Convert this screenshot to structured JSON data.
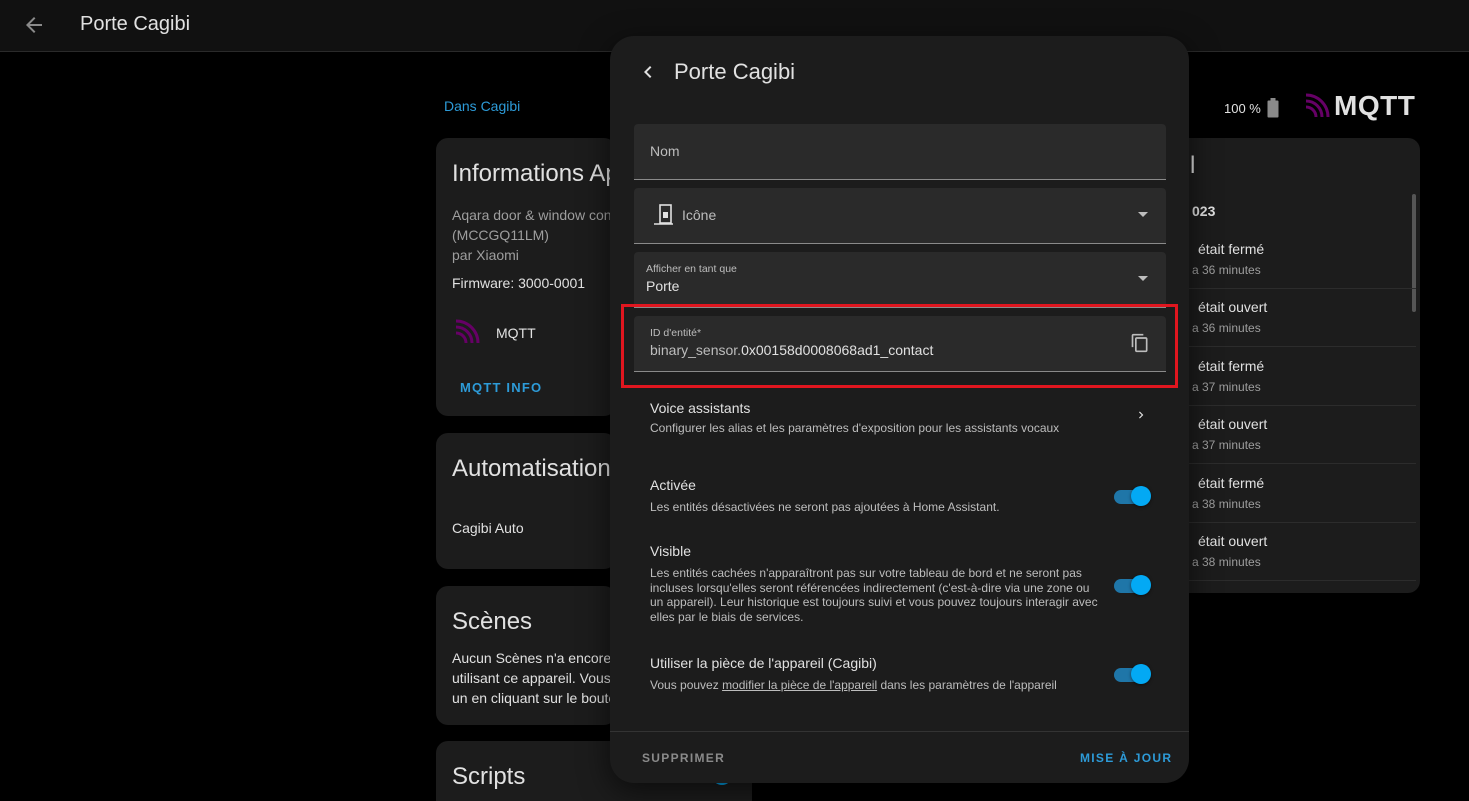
{
  "topbar": {
    "title": "Porte Cagibi"
  },
  "background": {
    "area_link": "Dans Cagibi",
    "battery": "100 %",
    "mqtt_logo_text": "MQTT",
    "info_card": {
      "title": "Informations Ap",
      "model_line1": "Aqara door & window con",
      "model_line2": "(MCCGQ11LM)",
      "manufacturer": "par Xiaomi",
      "firmware": "Firmware: 3000-0001",
      "integration": "MQTT",
      "button": "MQTT INFO"
    },
    "automation_card": {
      "title": "Automatisation",
      "item": "Cagibi Auto"
    },
    "scenes_card": {
      "title": "Scènes",
      "line1": "Aucun Scènes n'a encore",
      "line2": "utilisant ce appareil. Vous",
      "line3": "un en cliquant sur le bouto"
    },
    "scripts_card": {
      "title": "Scripts"
    },
    "logbook": {
      "header_fragment": "l",
      "date_fragment": "023",
      "items": [
        {
          "text": "était fermé",
          "time": "a 36 minutes"
        },
        {
          "text": "était ouvert",
          "time": "a 36 minutes"
        },
        {
          "text": "était fermé",
          "time": "a 37 minutes"
        },
        {
          "text": "était ouvert",
          "time": "a 37 minutes"
        },
        {
          "text": "était fermé",
          "time": "a 38 minutes"
        },
        {
          "text": "était ouvert",
          "time": "a 38 minutes"
        }
      ]
    }
  },
  "dialog": {
    "title": "Porte Cagibi",
    "name_field": {
      "label": "Nom",
      "value": ""
    },
    "icon_field": {
      "label": "Icône"
    },
    "device_class_field": {
      "label": "Afficher en tant que",
      "value": "Porte"
    },
    "entity_id_field": {
      "label": "ID d'entité*",
      "prefix": "binary_sensor.",
      "value": "0x00158d0008068ad1_contact"
    },
    "voice": {
      "title": "Voice assistants",
      "desc": "Configurer les alias et les paramètres d'exposition pour les assistants vocaux"
    },
    "enabled": {
      "title": "Activée",
      "desc": "Les entités désactivées ne seront pas ajoutées à Home Assistant.",
      "on": true
    },
    "visible": {
      "title": "Visible",
      "desc": "Les entités cachées n'apparaîtront pas sur votre tableau de bord et ne seront pas incluses lorsqu'elles seront référencées indirectement (c'est-à-dire via une zone ou un appareil). Leur historique est toujours suivi et vous pouvez toujours interagir avec elles par le biais de services.",
      "on": true
    },
    "use_device_area": {
      "title": "Utiliser la pièce de l'appareil (Cagibi)",
      "desc_before": "Vous pouvez",
      "desc_link": "modifier la pièce de l'appareil",
      "desc_after": "dans les paramètres de l'appareil",
      "on": true
    },
    "delete_button": "SUPPRIMER",
    "update_button": "MISE À JOUR"
  },
  "colors": {
    "accent": "#03a9f4",
    "link": "#2d9bd8",
    "highlight_box": "#e0161f",
    "mqtt_purple": "#660066"
  }
}
